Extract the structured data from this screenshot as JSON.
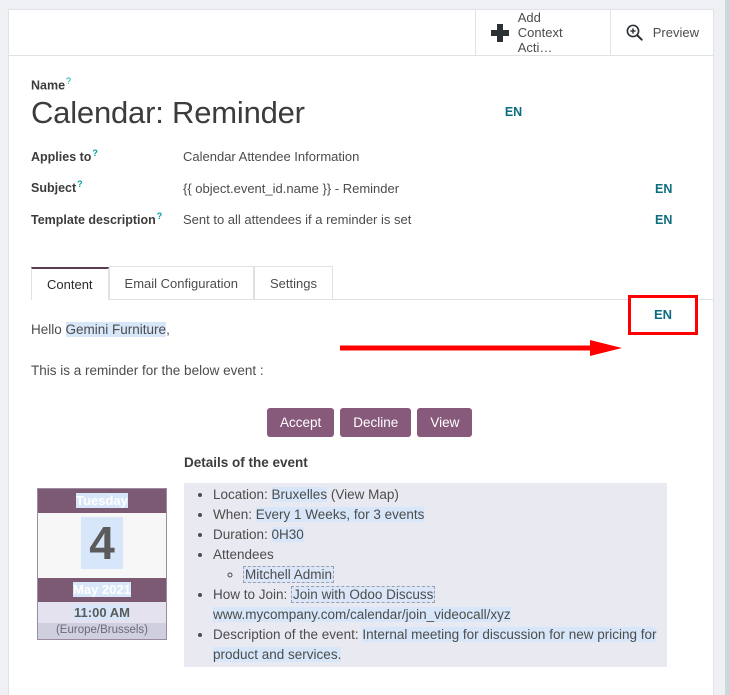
{
  "window": {
    "background": "#eef0f3"
  },
  "statusbar": {
    "buttons": [
      {
        "id": "add-context-action",
        "icon": "plus-icon",
        "label": "Add\nContext Acti…"
      },
      {
        "id": "preview",
        "icon": "magnifier-plus-icon",
        "label": "Preview"
      }
    ]
  },
  "form": {
    "name": {
      "label": "Name",
      "help": "?",
      "value": "Calendar: Reminder",
      "translate": "EN"
    },
    "applies_to": {
      "label": "Applies to",
      "help": "?",
      "value": "Calendar Attendee Information"
    },
    "subject": {
      "label": "Subject",
      "help": "?",
      "value": "{{ object.event_id.name }} - Reminder",
      "translate": "EN"
    },
    "template_description": {
      "label": "Template description",
      "help": "?",
      "value": "Sent to all attendees if a reminder is set",
      "translate": "EN"
    }
  },
  "tabs": [
    {
      "id": "content",
      "label": "Content",
      "active": true
    },
    {
      "id": "email-configuration",
      "label": "Email Configuration",
      "active": false
    },
    {
      "id": "settings",
      "label": "Settings",
      "active": false
    }
  ],
  "content": {
    "translate": "EN",
    "greeting_prefix": "Hello ",
    "greeting_name": "Gemini Furniture",
    "greeting_suffix": ",",
    "intro": "This is a reminder for the below event :",
    "actions": [
      {
        "id": "accept",
        "label": "Accept"
      },
      {
        "id": "decline",
        "label": "Decline"
      },
      {
        "id": "view",
        "label": "View"
      }
    ],
    "details_title": "Details of the event",
    "calendar_card": {
      "weekday": "Tuesday",
      "day": "4",
      "month_year": "May 2021",
      "time": "11:00 AM",
      "timezone": "(Europe/Brussels)"
    },
    "details": {
      "location_label": "Location: ",
      "location_value": "Bruxelles",
      "location_suffix": " (View Map)",
      "when_label": "When: ",
      "when_value": "Every 1 Weeks, for 3 events",
      "duration_label": "Duration: ",
      "duration_value": "0H30",
      "attendees_label": "Attendees",
      "attendee_1": "Mitchell Admin",
      "how_to_join_label": "How to Join: ",
      "how_to_join_link": "Join with Odoo Discuss",
      "how_to_join_url": "www.mycompany.com/calendar/join_videocall/xyz",
      "description_label": "Description of the event: ",
      "description_value": "Internal meeting for discussion for new pricing for product and services."
    }
  },
  "annotation": {
    "arrow_color": "#ff0000",
    "highlight_box_color": "#ff0000"
  },
  "colors": {
    "brand_purple": "#875A7B",
    "calendar_purple": "#7d5a74",
    "translate_link": "#0E6E81",
    "help_icon": "#00A09D",
    "text_highlight": "#d7e6f8",
    "details_block": "#e9e9f1"
  }
}
